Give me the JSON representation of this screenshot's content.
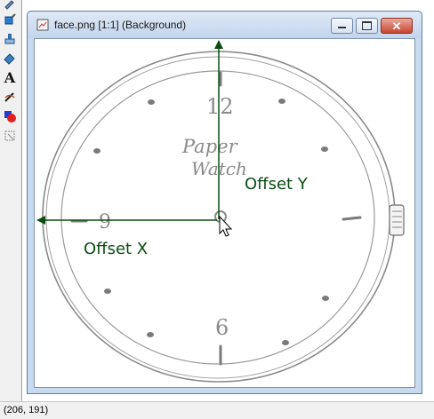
{
  "window": {
    "title": "face.png [1:1] (Background)"
  },
  "toolbar": {
    "tools": [
      "eyedropper-tool-icon",
      "fill-bucket-icon",
      "stamp-icon",
      "eraser-icon",
      "text-icon",
      "pen-icon",
      "color-shape-icon",
      "select-icon"
    ],
    "text_glyph": "A"
  },
  "watch": {
    "brand_line1": "Paper",
    "brand_line2": "Watch",
    "numeral_12": "12",
    "numeral_9": "9",
    "numeral_6": "6"
  },
  "annotations": {
    "offset_x": "Offset X",
    "offset_y": "Offset Y",
    "color": "#0a4d12"
  },
  "status": {
    "coords": "(206, 191)"
  }
}
